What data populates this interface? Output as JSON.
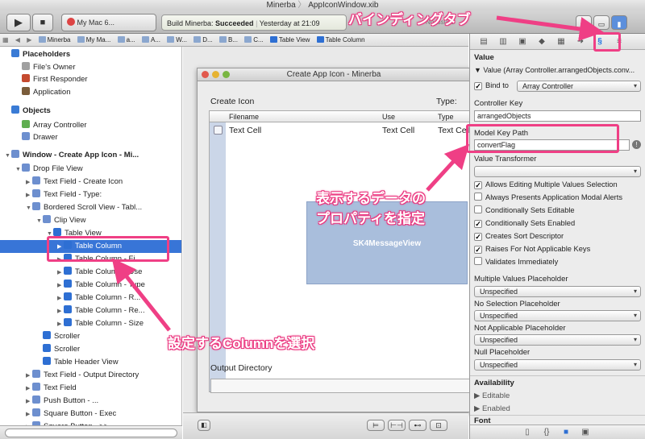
{
  "window": {
    "title": "Minerba",
    "document": "AppIconWindow.xib"
  },
  "toolbar": {
    "scheme": "My Mac 6...",
    "status_build": "Build Minerba: ",
    "status_result": "Succeeded",
    "status_time": "Yesterday at 21:09",
    "issues": "No Issues"
  },
  "jumpbar": {
    "items": [
      "Minerba",
      "My Ma...",
      "a...",
      "A...",
      "W...",
      "D...",
      "B...",
      "C...",
      "Table View",
      "Table Column"
    ]
  },
  "outline": {
    "rows": [
      {
        "label": "Placeholders",
        "indent": 0,
        "bold": true,
        "icon": "cube-icon",
        "color": "#3a7bd5"
      },
      {
        "label": "File's Owner",
        "indent": 1,
        "icon": "file-icon",
        "color": "#a0a0a0"
      },
      {
        "label": "First Responder",
        "indent": 1,
        "icon": "responder-icon",
        "color": "#c54a2f"
      },
      {
        "label": "Application",
        "indent": 1,
        "icon": "app-icon",
        "color": "#7a5c3a"
      },
      {
        "label": "Objects",
        "indent": 0,
        "bold": true,
        "icon": "cube-icon",
        "color": "#3a7bd5"
      },
      {
        "label": "Array Controller",
        "indent": 1,
        "icon": "controller-icon",
        "color": "#5fae50"
      },
      {
        "label": "Drawer",
        "indent": 1,
        "icon": "drawer-icon",
        "color": "#6d8fcf"
      },
      {
        "label": "Window - Create App Icon - Mi...",
        "indent": 0,
        "bold": true,
        "tri": "▼",
        "icon": "window-icon",
        "color": "#6d8fcf"
      },
      {
        "label": "Drop File View",
        "indent": 1,
        "tri": "▼",
        "icon": "view-icon",
        "color": "#6d8fcf"
      },
      {
        "label": "Text Field - Create Icon",
        "indent": 2,
        "tri": "▶",
        "icon": "textfield-icon",
        "color": "#6d8fcf"
      },
      {
        "label": "Text Field - Type:",
        "indent": 2,
        "tri": "▶",
        "icon": "textfield-icon",
        "color": "#6d8fcf"
      },
      {
        "label": "Bordered Scroll View - Tabl...",
        "indent": 2,
        "tri": "▼",
        "icon": "scrollview-icon",
        "color": "#6d8fcf"
      },
      {
        "label": "Clip View",
        "indent": 3,
        "tri": "▼",
        "icon": "clipview-icon",
        "color": "#6d8fcf"
      },
      {
        "label": "Table View",
        "indent": 4,
        "tri": "▼",
        "icon": "tableview-icon",
        "color": "#2e6fd3"
      },
      {
        "label": "Table Column",
        "indent": 5,
        "tri": "▶",
        "icon": "column-icon",
        "color": "#2e6fd3",
        "selected": true
      },
      {
        "label": "Table Column - Fi...",
        "indent": 5,
        "tri": "▶",
        "icon": "column-icon",
        "color": "#2e6fd3"
      },
      {
        "label": "Table Column - Use",
        "indent": 5,
        "tri": "▶",
        "icon": "column-icon",
        "color": "#2e6fd3"
      },
      {
        "label": "Table Column - Type",
        "indent": 5,
        "tri": "▶",
        "icon": "column-icon",
        "color": "#2e6fd3"
      },
      {
        "label": "Table Column - R...",
        "indent": 5,
        "tri": "▶",
        "icon": "column-icon",
        "color": "#2e6fd3"
      },
      {
        "label": "Table Column - Re...",
        "indent": 5,
        "tri": "▶",
        "icon": "column-icon",
        "color": "#2e6fd3"
      },
      {
        "label": "Table Column - Size",
        "indent": 5,
        "tri": "▶",
        "icon": "column-icon",
        "color": "#2e6fd3"
      },
      {
        "label": "Scroller",
        "indent": 3,
        "icon": "scroller-icon",
        "color": "#2e6fd3"
      },
      {
        "label": "Scroller",
        "indent": 3,
        "icon": "scroller-icon",
        "color": "#2e6fd3"
      },
      {
        "label": "Table Header View",
        "indent": 3,
        "icon": "header-icon",
        "color": "#2e6fd3"
      },
      {
        "label": "Text Field - Output Directory",
        "indent": 2,
        "tri": "▶",
        "icon": "textfield-icon",
        "color": "#6d8fcf"
      },
      {
        "label": "Text Field",
        "indent": 2,
        "tri": "▶",
        "icon": "textfield-icon",
        "color": "#6d8fcf"
      },
      {
        "label": "Push Button - ...",
        "indent": 2,
        "tri": "▶",
        "icon": "button-icon",
        "color": "#6d8fcf"
      },
      {
        "label": "Square Button - Exec",
        "indent": 2,
        "tri": "▶",
        "icon": "button-icon",
        "color": "#6d8fcf"
      },
      {
        "label": "Square Button - >>",
        "indent": 2,
        "tri": "▶",
        "icon": "button-icon",
        "color": "#6d8fcf"
      }
    ]
  },
  "canvas": {
    "window_title": "Create App Icon - Minerba",
    "create_icon_label": "Create Icon",
    "type_label": "Type:",
    "columns": [
      "Filename",
      "Use",
      "Type"
    ],
    "cells": [
      "Text Cell",
      "Text Cell",
      "Text Cell"
    ],
    "message_view": "SK4MessageView",
    "output_directory": "Output Directory"
  },
  "inspector": {
    "value_section": "Value",
    "value_disclosure": "Value (Array Controller.arrangedObjects.conv...",
    "bind_to_label": "Bind to",
    "bind_to_value": "Array Controller",
    "controller_key_label": "Controller Key",
    "controller_key_value": "arrangedObjects",
    "model_key_path_label": "Model Key Path",
    "model_key_path_value": "convertFlag",
    "value_transformer_label": "Value Transformer",
    "options": [
      {
        "label": "Allows Editing Multiple Values Selection",
        "checked": true
      },
      {
        "label": "Always Presents Application Modal Alerts",
        "checked": false
      },
      {
        "label": "Conditionally Sets Editable",
        "checked": false
      },
      {
        "label": "Conditionally Sets Enabled",
        "checked": true
      },
      {
        "label": "Creates Sort Descriptor",
        "checked": true
      },
      {
        "label": "Raises For Not Applicable Keys",
        "checked": true
      },
      {
        "label": "Validates Immediately",
        "checked": false
      }
    ],
    "multiple_values_label": "Multiple Values Placeholder",
    "multiple_values_value": "Unspecified",
    "no_selection_label": "No Selection Placeholder",
    "no_selection_value": "Unspecified",
    "not_applicable_label": "Not Applicable Placeholder",
    "not_applicable_value": "Unspecified",
    "null_label": "Null Placeholder",
    "null_value": "Unspecified",
    "availability_section": "Availability",
    "editable_label": "Editable",
    "enabled_label": "Enabled",
    "font_section": "Font"
  },
  "annotations": {
    "binding_tab": "バインディングタブ",
    "property_line1": "表示するデータの",
    "property_line2": "プロパティを指定",
    "select_column": "設定するColumnを選択",
    "color": "#ef3f85"
  }
}
